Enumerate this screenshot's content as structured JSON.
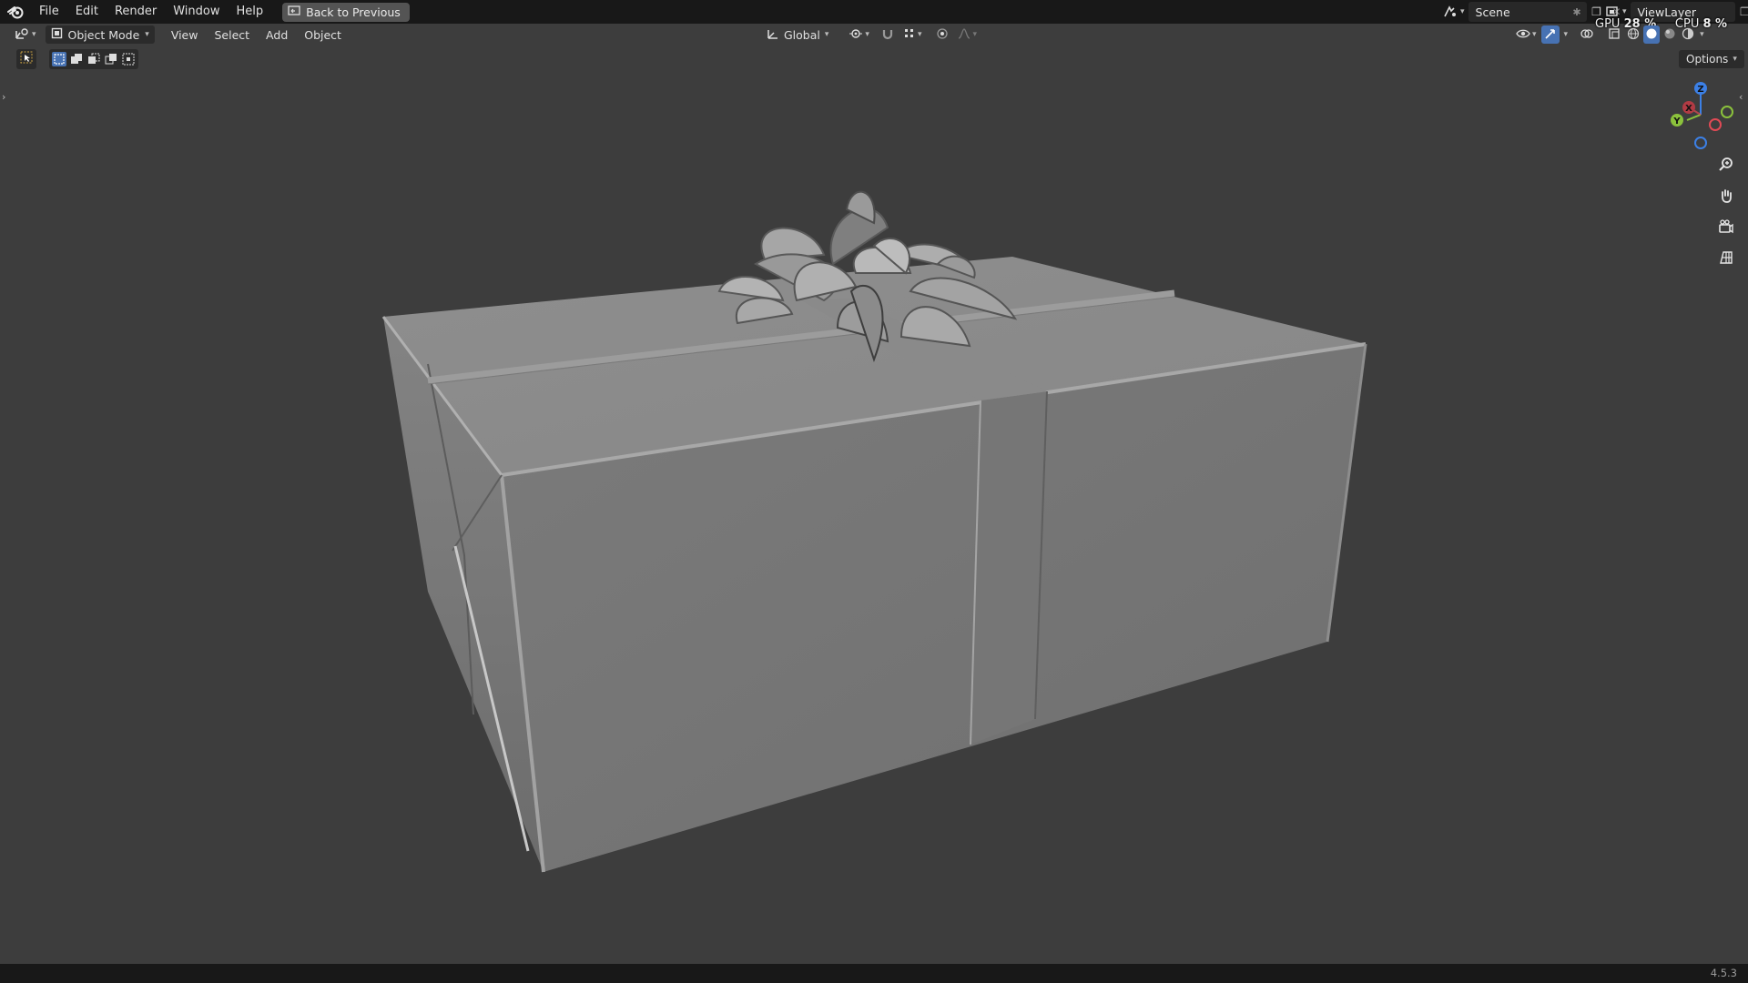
{
  "topbar": {
    "menus": [
      "File",
      "Edit",
      "Render",
      "Window",
      "Help"
    ],
    "back_label": "Back to Previous",
    "scene_name": "Scene",
    "view_layer": "ViewLayer"
  },
  "stats": {
    "gpu_label": "GPU",
    "gpu_value": "28 %",
    "cpu_label": "CPU",
    "cpu_value": "8 %"
  },
  "header": {
    "mode": "Object Mode",
    "menus": [
      "View",
      "Select",
      "Add",
      "Object"
    ],
    "transform_orientation": "Global"
  },
  "viewport": {
    "options_label": "Options",
    "gizmo_axes": {
      "x": "X",
      "y": "Y",
      "z": "Z"
    }
  },
  "statusbar": {
    "version": "4.5.3"
  },
  "colors": {
    "background": "#3d3d3d",
    "bar": "#181818",
    "accent_blue": "#4772b3",
    "axis_x": "#e14a55",
    "axis_y": "#8bc23c",
    "axis_z": "#3c80e6"
  }
}
